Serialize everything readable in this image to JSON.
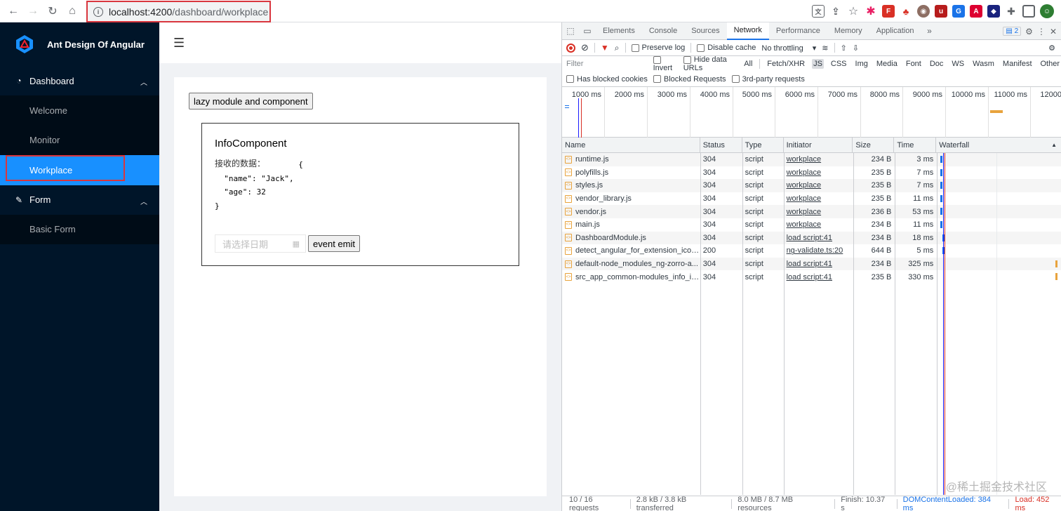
{
  "browser": {
    "url_host": "localhost:4200",
    "url_path": "/dashboard/workplace"
  },
  "sidebar": {
    "app_title": "Ant Design Of Angular",
    "groups": [
      {
        "label": "Dashboard",
        "items": [
          "Welcome",
          "Monitor",
          "Workplace"
        ]
      },
      {
        "label": "Form",
        "items": [
          "Basic Form"
        ]
      }
    ],
    "active_item": "Workplace"
  },
  "content": {
    "lazy_button": "lazy module and component",
    "info_title": "InfoComponent",
    "received_label": "接收的数据：",
    "json_text": "                  {\n  \"name\": \"Jack\",\n  \"age\": 32\n}",
    "date_placeholder": "请选择日期",
    "emit_button": "event emit"
  },
  "devtools": {
    "tabs": [
      "Elements",
      "Console",
      "Sources",
      "Network",
      "Performance",
      "Memory",
      "Application"
    ],
    "active_tab": "Network",
    "issues_count": "2",
    "toolbar": {
      "preserve_log": "Preserve log",
      "disable_cache": "Disable cache",
      "throttling": "No throttling"
    },
    "filter": {
      "placeholder": "Filter",
      "invert": "Invert",
      "hide_data_urls": "Hide data URLs",
      "types": [
        "All",
        "Fetch/XHR",
        "JS",
        "CSS",
        "Img",
        "Media",
        "Font",
        "Doc",
        "WS",
        "Wasm",
        "Manifest",
        "Other"
      ],
      "active_type": "JS",
      "has_blocked_cookies": "Has blocked cookies",
      "blocked_requests": "Blocked Requests",
      "third_party": "3rd-party requests"
    },
    "overview_ticks": [
      "1000 ms",
      "2000 ms",
      "3000 ms",
      "4000 ms",
      "5000 ms",
      "6000 ms",
      "7000 ms",
      "8000 ms",
      "9000 ms",
      "10000 ms",
      "11000 ms",
      "12000"
    ],
    "columns": [
      "Name",
      "Status",
      "Type",
      "Initiator",
      "Size",
      "Time",
      "Waterfall"
    ],
    "rows": [
      {
        "name": "runtime.js",
        "status": "304",
        "type": "script",
        "initiator": "workplace",
        "size": "234 B",
        "time": "3 ms"
      },
      {
        "name": "polyfills.js",
        "status": "304",
        "type": "script",
        "initiator": "workplace",
        "size": "235 B",
        "time": "7 ms"
      },
      {
        "name": "styles.js",
        "status": "304",
        "type": "script",
        "initiator": "workplace",
        "size": "235 B",
        "time": "7 ms"
      },
      {
        "name": "vendor_library.js",
        "status": "304",
        "type": "script",
        "initiator": "workplace",
        "size": "235 B",
        "time": "11 ms"
      },
      {
        "name": "vendor.js",
        "status": "304",
        "type": "script",
        "initiator": "workplace",
        "size": "236 B",
        "time": "53 ms"
      },
      {
        "name": "main.js",
        "status": "304",
        "type": "script",
        "initiator": "workplace",
        "size": "234 B",
        "time": "11 ms"
      },
      {
        "name": "DashboardModule.js",
        "status": "304",
        "type": "script",
        "initiator": "load script:41",
        "size": "234 B",
        "time": "18 ms"
      },
      {
        "name": "detect_angular_for_extension_icon_...",
        "status": "200",
        "type": "script",
        "initiator": "ng-validate.ts:20",
        "size": "644 B",
        "time": "5 ms"
      },
      {
        "name": "default-node_modules_ng-zorro-a...",
        "status": "304",
        "type": "script",
        "initiator": "load script:41",
        "size": "234 B",
        "time": "325 ms"
      },
      {
        "name": "src_app_common-modules_info_inf...",
        "status": "304",
        "type": "script",
        "initiator": "load script:41",
        "size": "235 B",
        "time": "330 ms"
      }
    ],
    "status_bar": {
      "requests": "10 / 16 requests",
      "transferred": "2.8 kB / 3.8 kB transferred",
      "resources": "8.0 MB / 8.7 MB resources",
      "finish": "Finish: 10.37 s",
      "dom_loaded": "DOMContentLoaded: 384 ms",
      "load": "Load: 452 ms"
    },
    "watermark": "@稀土掘金技术社区"
  },
  "colors": {
    "sidebar_bg": "#001529",
    "active_item": "#1890ff",
    "highlight_border": "#d9363e"
  }
}
